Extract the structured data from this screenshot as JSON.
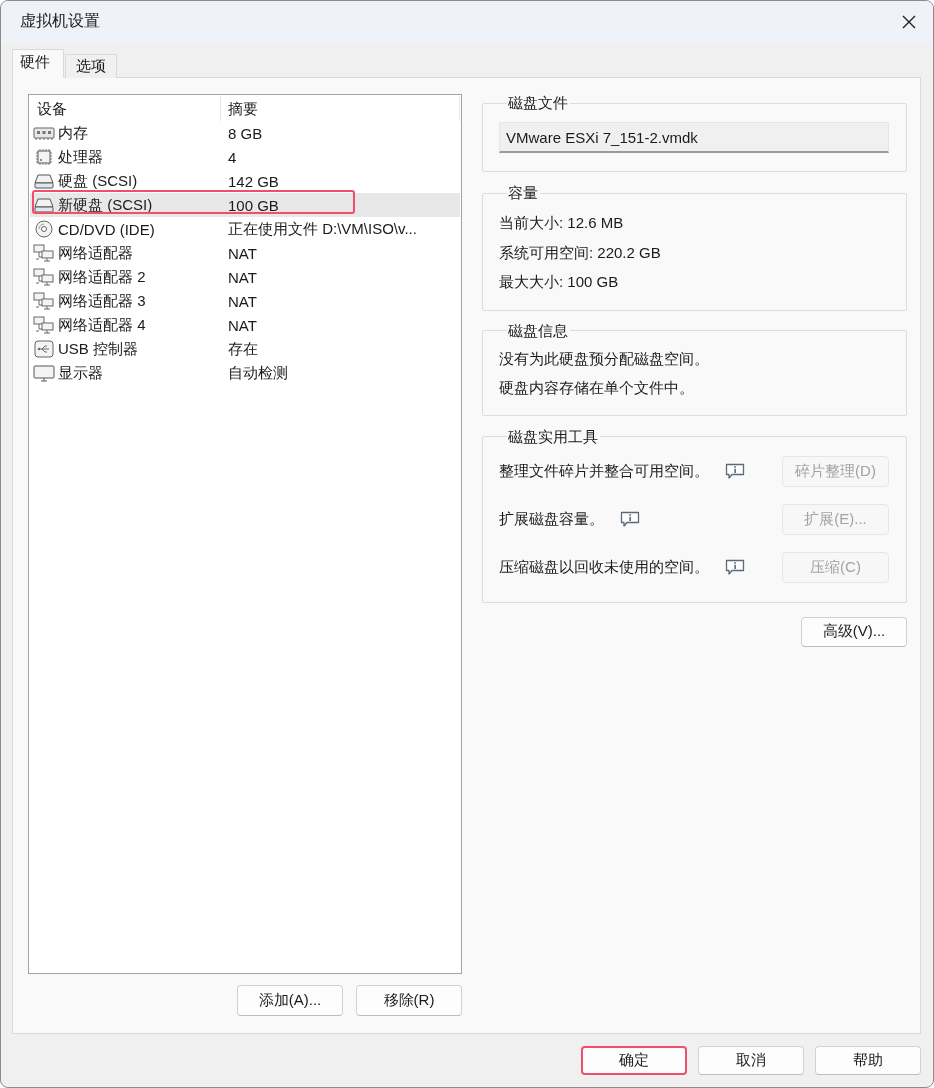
{
  "window": {
    "title": "虚拟机设置"
  },
  "tabs": [
    {
      "label": "硬件",
      "selected": true
    },
    {
      "label": "选项",
      "selected": false
    }
  ],
  "device_list": {
    "columns": [
      "设备",
      "摘要"
    ],
    "rows": [
      {
        "kind": "memory",
        "device": "内存",
        "summary": "8 GB",
        "selected": false,
        "highlighted": false
      },
      {
        "kind": "cpu",
        "device": "处理器",
        "summary": "4",
        "selected": false,
        "highlighted": false
      },
      {
        "kind": "disk",
        "device": "硬盘 (SCSI)",
        "summary": "142 GB",
        "selected": false,
        "highlighted": false
      },
      {
        "kind": "disk",
        "device": "新硬盘 (SCSI)",
        "summary": "100 GB",
        "selected": true,
        "highlighted": true
      },
      {
        "kind": "cdrom",
        "device": "CD/DVD (IDE)",
        "summary": "正在使用文件 D:\\VM\\ISO\\v...",
        "selected": false,
        "highlighted": false
      },
      {
        "kind": "network",
        "device": "网络适配器",
        "summary": "NAT",
        "selected": false,
        "highlighted": false
      },
      {
        "kind": "network",
        "device": "网络适配器 2",
        "summary": "NAT",
        "selected": false,
        "highlighted": false
      },
      {
        "kind": "network",
        "device": "网络适配器 3",
        "summary": "NAT",
        "selected": false,
        "highlighted": false
      },
      {
        "kind": "network",
        "device": "网络适配器 4",
        "summary": "NAT",
        "selected": false,
        "highlighted": false
      },
      {
        "kind": "usb",
        "device": "USB 控制器",
        "summary": "存在",
        "selected": false,
        "highlighted": false
      },
      {
        "kind": "display",
        "device": "显示器",
        "summary": "自动检测",
        "selected": false,
        "highlighted": false
      }
    ]
  },
  "device_buttons": [
    {
      "label": "添加(A)..."
    },
    {
      "label": "移除(R)"
    }
  ],
  "disk_file": {
    "title": "磁盘文件",
    "value": "VMware ESXi 7_151-2.vmdk"
  },
  "capacity": {
    "title": "容量",
    "lines": [
      "当前大小: 12.6 MB",
      "系统可用空间: 220.2 GB",
      "最大大小: 100 GB"
    ]
  },
  "disk_info": {
    "title": "磁盘信息",
    "lines": [
      "没有为此硬盘预分配磁盘空间。",
      "硬盘内容存储在单个文件中。"
    ]
  },
  "disk_utilities": {
    "title": "磁盘实用工具",
    "items": [
      {
        "text": "整理文件碎片并整合可用空间。",
        "button": "碎片整理(D)",
        "disabled": true
      },
      {
        "text": "扩展磁盘容量。",
        "button": "扩展(E)...",
        "disabled": true
      },
      {
        "text": "压缩磁盘以回收未使用的空间。",
        "button": "压缩(C)",
        "disabled": true
      }
    ]
  },
  "advanced_button": {
    "label": "高级(V)..."
  },
  "dialog_buttons": [
    {
      "label": "确定",
      "highlighted": true
    },
    {
      "label": "取消",
      "highlighted": false
    },
    {
      "label": "帮助",
      "highlighted": false
    }
  ]
}
